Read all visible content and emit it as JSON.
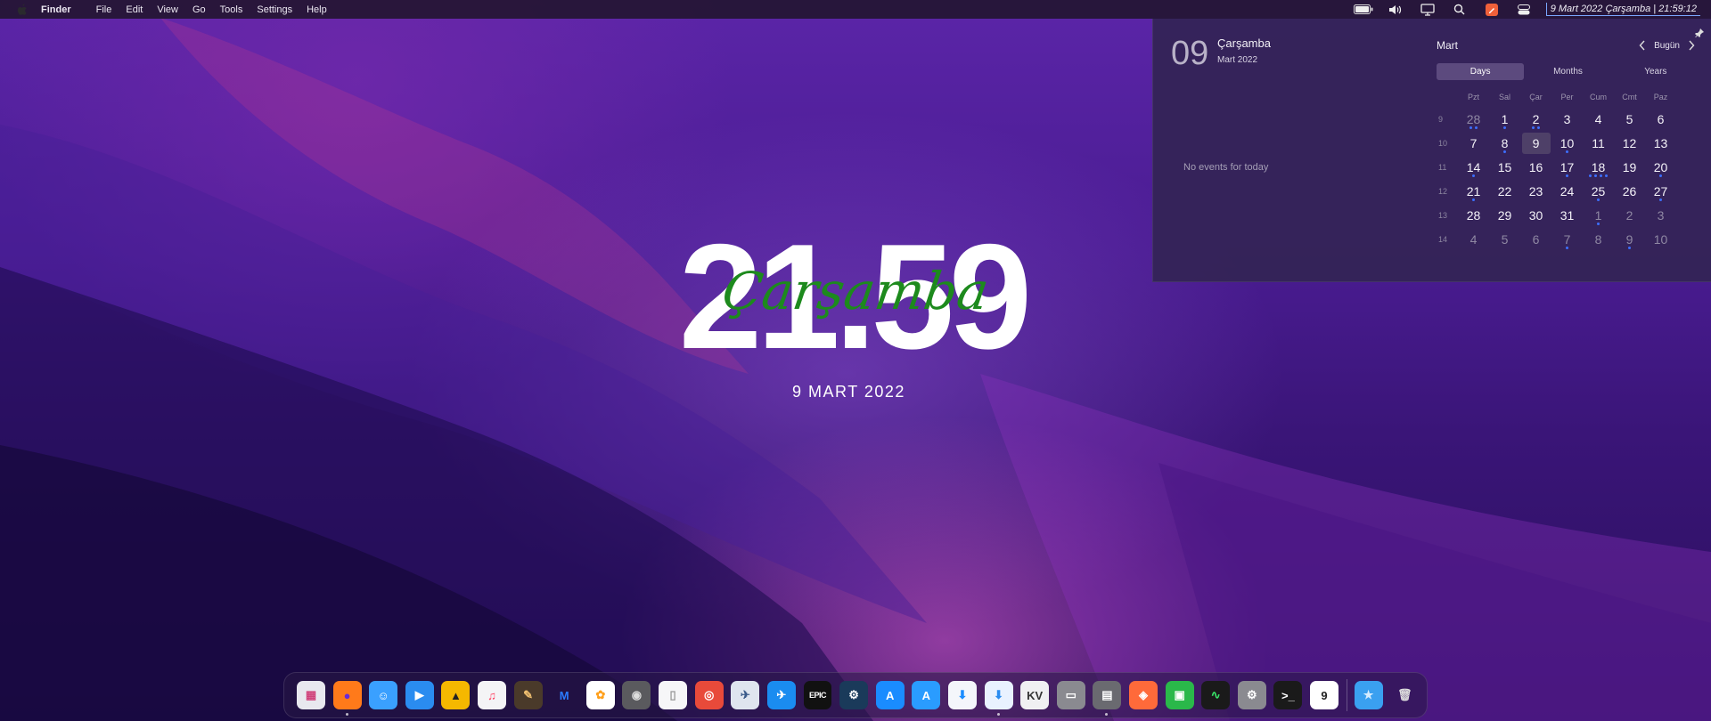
{
  "menubar": {
    "app_name": "Finder",
    "menus": [
      "File",
      "Edit",
      "View",
      "Go",
      "Tools",
      "Settings",
      "Help"
    ],
    "status_icons": [
      "battery-icon",
      "volume-icon",
      "display-icon",
      "search-icon",
      "pencil-app-icon",
      "toggle-icon"
    ],
    "clock_text": "9 Mart 2022 Çarşamba | 21:59:12"
  },
  "desktop_clock": {
    "time": "21.59",
    "day": "Çarşamba",
    "date": "9 MART 2022"
  },
  "calendar_panel": {
    "today_number": "09",
    "today_day": "Çarşamba",
    "today_month": "Mart 2022",
    "no_events": "No events for today",
    "month_label": "Mart",
    "today_button": "Bugün",
    "tabs": [
      "Days",
      "Months",
      "Years"
    ],
    "active_tab": "Days",
    "weekday_headers": [
      "Pzt",
      "Sal",
      "Çar",
      "Per",
      "Cum",
      "Cmt",
      "Paz"
    ],
    "weeks": [
      {
        "week": "9",
        "days": [
          {
            "d": "28",
            "other": true,
            "dots": 2
          },
          {
            "d": "1",
            "dots": 1
          },
          {
            "d": "2",
            "dots": 2
          },
          {
            "d": "3"
          },
          {
            "d": "4"
          },
          {
            "d": "5"
          },
          {
            "d": "6"
          }
        ]
      },
      {
        "week": "10",
        "days": [
          {
            "d": "7"
          },
          {
            "d": "8",
            "dots": 1
          },
          {
            "d": "9",
            "today": true
          },
          {
            "d": "10",
            "dots": 1
          },
          {
            "d": "11"
          },
          {
            "d": "12"
          },
          {
            "d": "13"
          }
        ]
      },
      {
        "week": "11",
        "days": [
          {
            "d": "14",
            "dots": 1
          },
          {
            "d": "15"
          },
          {
            "d": "16"
          },
          {
            "d": "17",
            "dots": 1
          },
          {
            "d": "18",
            "dots": 4
          },
          {
            "d": "19"
          },
          {
            "d": "20",
            "dots": 1
          }
        ]
      },
      {
        "week": "12",
        "days": [
          {
            "d": "21",
            "dots": 1
          },
          {
            "d": "22"
          },
          {
            "d": "23"
          },
          {
            "d": "24"
          },
          {
            "d": "25",
            "dots": 1
          },
          {
            "d": "26"
          },
          {
            "d": "27",
            "dots": 1
          }
        ]
      },
      {
        "week": "13",
        "days": [
          {
            "d": "28"
          },
          {
            "d": "29"
          },
          {
            "d": "30"
          },
          {
            "d": "31"
          },
          {
            "d": "1",
            "other": true,
            "dots": 1
          },
          {
            "d": "2",
            "other": true
          },
          {
            "d": "3",
            "other": true
          }
        ]
      },
      {
        "week": "14",
        "days": [
          {
            "d": "4",
            "other": true
          },
          {
            "d": "5",
            "other": true
          },
          {
            "d": "6",
            "other": true
          },
          {
            "d": "7",
            "other": true,
            "dots": 1
          },
          {
            "d": "8",
            "other": true
          },
          {
            "d": "9",
            "other": true,
            "dots": 1
          },
          {
            "d": "10",
            "other": true
          }
        ]
      }
    ]
  },
  "dock": {
    "apps": [
      {
        "name": "launchpad-icon",
        "color": "#e8e8ef",
        "glyph": "▦",
        "fg": "#d0407a"
      },
      {
        "name": "firefox-icon",
        "color": "#ff7a1a",
        "glyph": "●",
        "fg": "#6a2bd8",
        "running": true
      },
      {
        "name": "finder-icon",
        "color": "#3aa0ff",
        "glyph": "☺",
        "fg": "#ffffff"
      },
      {
        "name": "quicktime-icon",
        "color": "#2a8cf0",
        "glyph": "▶",
        "fg": "#ffffff"
      },
      {
        "name": "vlc-like-icon",
        "color": "#f5b800",
        "glyph": "▲",
        "fg": "#222222"
      },
      {
        "name": "music-icon",
        "color": "#f4f4f6",
        "glyph": "♫",
        "fg": "#ff3b5c"
      },
      {
        "name": "script-editor-icon",
        "color": "#4a3a2a",
        "glyph": "✎",
        "fg": "#f0c070"
      },
      {
        "name": "malwarebytes-icon",
        "color": "transparent",
        "glyph": "M",
        "fg": "#2a7bff"
      },
      {
        "name": "photos-icon",
        "color": "#ffffff",
        "glyph": "✿",
        "fg": "#ff9f1a"
      },
      {
        "name": "screenshot-icon",
        "color": "#5a5a5e",
        "glyph": "◉",
        "fg": "#dddddd"
      },
      {
        "name": "preview-icon",
        "color": "#f6f6f8",
        "glyph": "▯",
        "fg": "#999999"
      },
      {
        "name": "pdf-reader-icon",
        "color": "#e84a3a",
        "glyph": "◎",
        "fg": "#ffffff"
      },
      {
        "name": "xcode-like-icon",
        "color": "#dfe5ef",
        "glyph": "✈",
        "fg": "#3a5a8a"
      },
      {
        "name": "swift-icon",
        "color": "#1a8cf0",
        "glyph": "✈",
        "fg": "#ffffff"
      },
      {
        "name": "epic-games-icon",
        "color": "#111111",
        "glyph": "EPIC",
        "fg": "#ffffff"
      },
      {
        "name": "steam-icon",
        "color": "#1a3a5a",
        "glyph": "⚙",
        "fg": "#ffffff"
      },
      {
        "name": "app-store-icon",
        "color": "#1a8cff",
        "glyph": "A",
        "fg": "#ffffff"
      },
      {
        "name": "app-store-2-icon",
        "color": "#2a9cff",
        "glyph": "A",
        "fg": "#ffffff"
      },
      {
        "name": "downloader-icon",
        "color": "#f4f6fb",
        "glyph": "⬇",
        "fg": "#1a8cff"
      },
      {
        "name": "download-manager-icon",
        "color": "#e9f2ff",
        "glyph": "⬇",
        "fg": "#2a8cf0",
        "running": true
      },
      {
        "name": "archive-utility-icon",
        "color": "#f0f0f2",
        "glyph": "KV",
        "fg": "#333333"
      },
      {
        "name": "disk-utility-icon",
        "color": "#8a8a90",
        "glyph": "▭",
        "fg": "#ffffff"
      },
      {
        "name": "disk-drive-icon",
        "color": "#6a6a70",
        "glyph": "▤",
        "fg": "#ffffff",
        "running": true
      },
      {
        "name": "shield-app-icon",
        "color": "#ff6a3a",
        "glyph": "◈",
        "fg": "#ffffff"
      },
      {
        "name": "green-terminal-icon",
        "color": "#2ab84a",
        "glyph": "▣",
        "fg": "#ffffff"
      },
      {
        "name": "activity-monitor-icon",
        "color": "#1a1a1a",
        "glyph": "∿",
        "fg": "#3ae86a"
      },
      {
        "name": "system-preferences-icon",
        "color": "#8a8a90",
        "glyph": "⚙",
        "fg": "#ffffff"
      },
      {
        "name": "terminal-icon",
        "color": "#1a1a1a",
        "glyph": ">_",
        "fg": "#ffffff"
      },
      {
        "name": "calendar-icon",
        "color": "#ffffff",
        "glyph": "9",
        "fg": "#222222"
      },
      {
        "name": "folder-icon",
        "color": "#3aa0f0",
        "glyph": "★",
        "fg": "#d6ecff"
      },
      {
        "name": "trash-icon",
        "color": "transparent",
        "glyph": "🗑",
        "fg": "#dddddd"
      }
    ]
  }
}
